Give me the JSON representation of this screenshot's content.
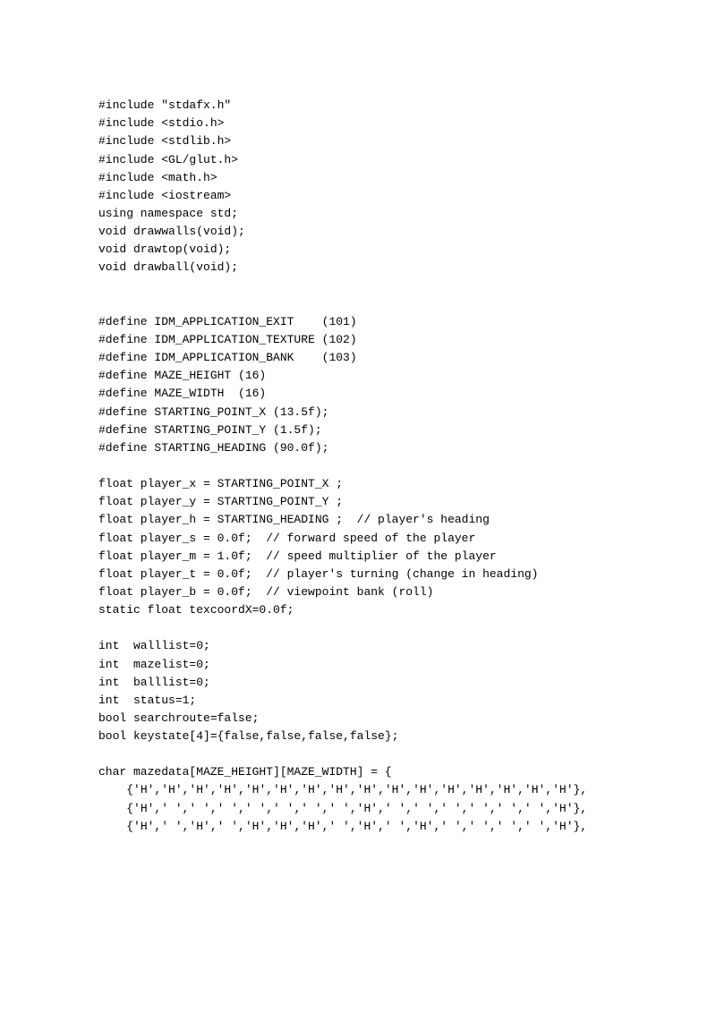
{
  "code": "#include \"stdafx.h\"\n#include <stdio.h>\n#include <stdlib.h>\n#include <GL/glut.h>\n#include <math.h>\n#include <iostream>\nusing namespace std;\nvoid drawwalls(void);\nvoid drawtop(void);\nvoid drawball(void);\n\n\n#define IDM_APPLICATION_EXIT    (101)\n#define IDM_APPLICATION_TEXTURE (102)\n#define IDM_APPLICATION_BANK    (103)\n#define MAZE_HEIGHT (16)\n#define MAZE_WIDTH  (16)\n#define STARTING_POINT_X (13.5f);\n#define STARTING_POINT_Y (1.5f);\n#define STARTING_HEADING (90.0f);\n\nfloat player_x = STARTING_POINT_X ;\nfloat player_y = STARTING_POINT_Y ;\nfloat player_h = STARTING_HEADING ;  // player's heading\nfloat player_s = 0.0f;  // forward speed of the player\nfloat player_m = 1.0f;  // speed multiplier of the player\nfloat player_t = 0.0f;  // player's turning (change in heading)\nfloat player_b = 0.0f;  // viewpoint bank (roll)\nstatic float texcoordX=0.0f;\n\nint  walllist=0;\nint  mazelist=0;\nint  balllist=0;\nint  status=1;\nbool searchroute=false;\nbool keystate[4]={false,false,false,false};\n\nchar mazedata[MAZE_HEIGHT][MAZE_WIDTH] = {\n    {'H','H','H','H','H','H','H','H','H','H','H','H','H','H','H','H'},\n    {'H',' ',' ',' ',' ',' ',' ',' ','H',' ',' ',' ',' ',' ',' ','H'},\n    {'H',' ','H',' ','H','H','H',' ','H',' ','H',' ',' ',' ',' ','H'},"
}
